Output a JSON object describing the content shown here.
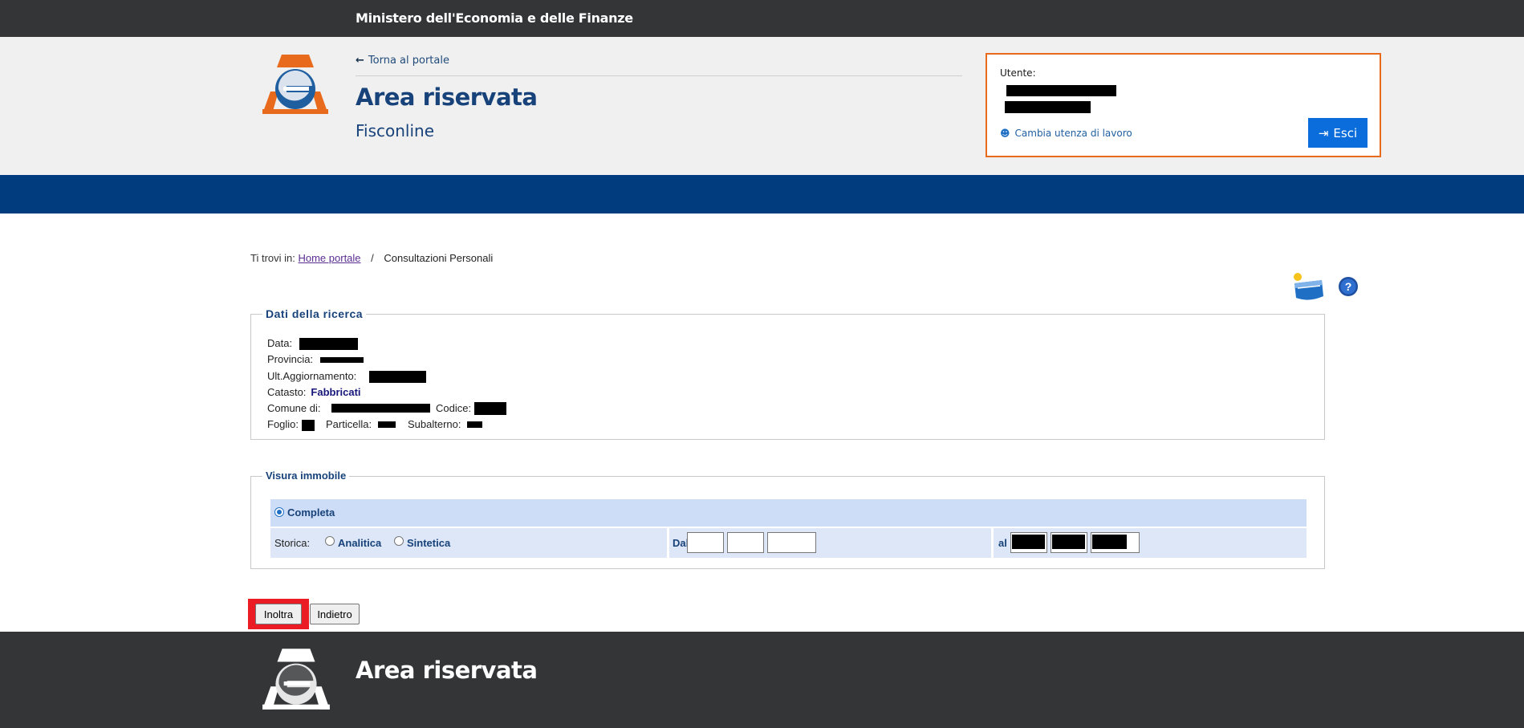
{
  "topbar": {
    "ministry": "Ministero dell'Economia e delle Finanze"
  },
  "header": {
    "back_link": "Torna al portale",
    "title": "Area riservata",
    "subtitle": "Fisconline"
  },
  "user_box": {
    "utente_label": "Utente:",
    "change_label": "Cambia utenza di lavoro",
    "logout_label": "Esci"
  },
  "breadcrumb": {
    "prefix": "Ti trovi in:",
    "home": "Home portale",
    "separator": "/",
    "current": "Consultazioni Personali"
  },
  "search_data": {
    "legend": "Dati della ricerca",
    "data_label": "Data:",
    "provincia_label": "Provincia:",
    "ult_agg_label": "Ult.Aggiornamento:",
    "catasto_label": "Catasto:",
    "catasto_value": "Fabbricati",
    "comune_label": "Comune di:",
    "codice_label": "Codice:",
    "foglio_label": "Foglio:",
    "particella_label": "Particella:",
    "subalterno_label": "Subalterno:"
  },
  "visura": {
    "legend": "Visura immobile",
    "completa_label": "Completa",
    "storica_label": "Storica:",
    "analitica_label": "Analitica",
    "sintetica_label": "Sintetica",
    "dal_label": "Dal",
    "al_label": "al"
  },
  "actions": {
    "submit_label": "Inoltra",
    "back_label": "Indietro"
  },
  "footer": {
    "title": "Area riservata"
  },
  "colors": {
    "brand_blue": "#003c7e",
    "title_blue": "#17427a",
    "accent_orange": "#e86a1d",
    "button_blue": "#0a6ddb",
    "dark_bar": "#333537",
    "highlight_red": "#ec1c24"
  }
}
